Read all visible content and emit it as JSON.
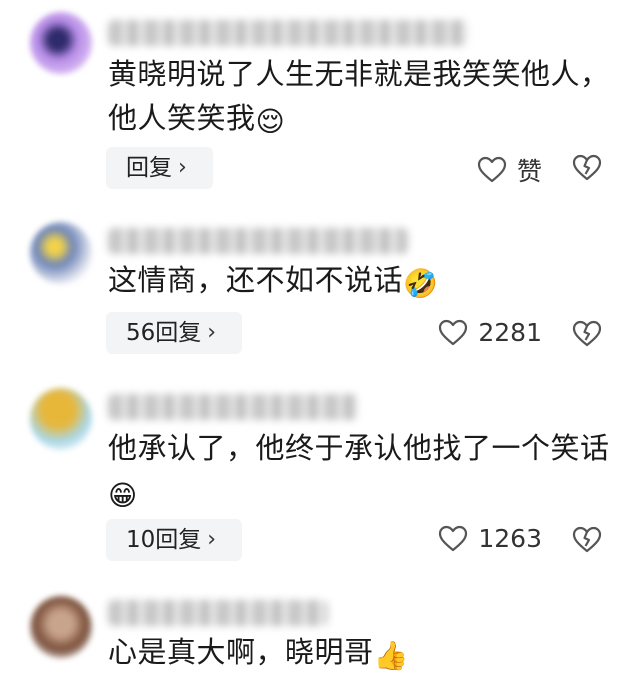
{
  "comments": [
    {
      "avatar_color": "#b58be6",
      "text": "黄晓明说了人生无非就是我笑笑他人，他人笑笑我",
      "emoji": "😌",
      "reply_label": "回复",
      "like_label": "赞"
    },
    {
      "avatar_color": "#6f86b8",
      "text": "这情商，还不如不说话",
      "emoji": "🤣",
      "reply_label": "56回复",
      "like_label": "2281"
    },
    {
      "avatar_color": "#e7b73a",
      "text": "他承认了，他终于承认他找了一个笑话",
      "emoji": "😁",
      "reply_label": "10回复",
      "like_label": "1263"
    },
    {
      "avatar_color": "#7a4f3a",
      "text": "心是真大啊，晓明哥",
      "emoji": "👍",
      "reply_label": "",
      "like_label": ""
    }
  ],
  "icons": {
    "reply_chevron": "chevron-right-icon",
    "like": "heart-outline-icon",
    "dislike": "broken-heart-icon"
  }
}
